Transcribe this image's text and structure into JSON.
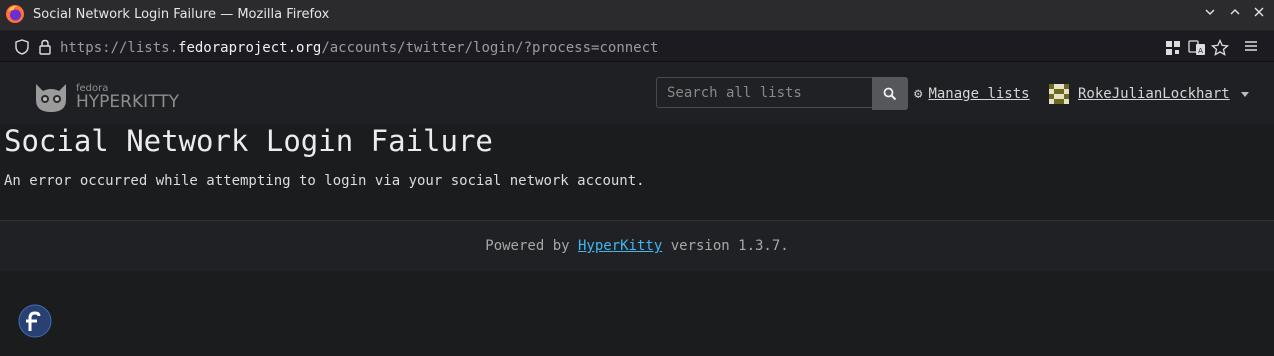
{
  "window": {
    "title": "Social Network Login Failure — Mozilla Firefox"
  },
  "urlbar": {
    "prefix": "https://lists.",
    "host": "fedoraproject.org",
    "path": "/accounts/twitter/login/?process=connect"
  },
  "header": {
    "logo_small": "fedora",
    "logo_big": "HYPERKITTY",
    "search_placeholder": "Search all lists",
    "manage_lists": "Manage lists",
    "username": "RokeJulianLockhart"
  },
  "main": {
    "heading": "Social Network Login Failure",
    "message": "An error occurred while attempting to login via your social network account."
  },
  "footer": {
    "powered_by": "Powered by ",
    "link": "HyperKitty",
    "version": " version 1.3.7."
  },
  "colors": {
    "link": "#3fb7f0",
    "background": "#1b1c1e"
  }
}
